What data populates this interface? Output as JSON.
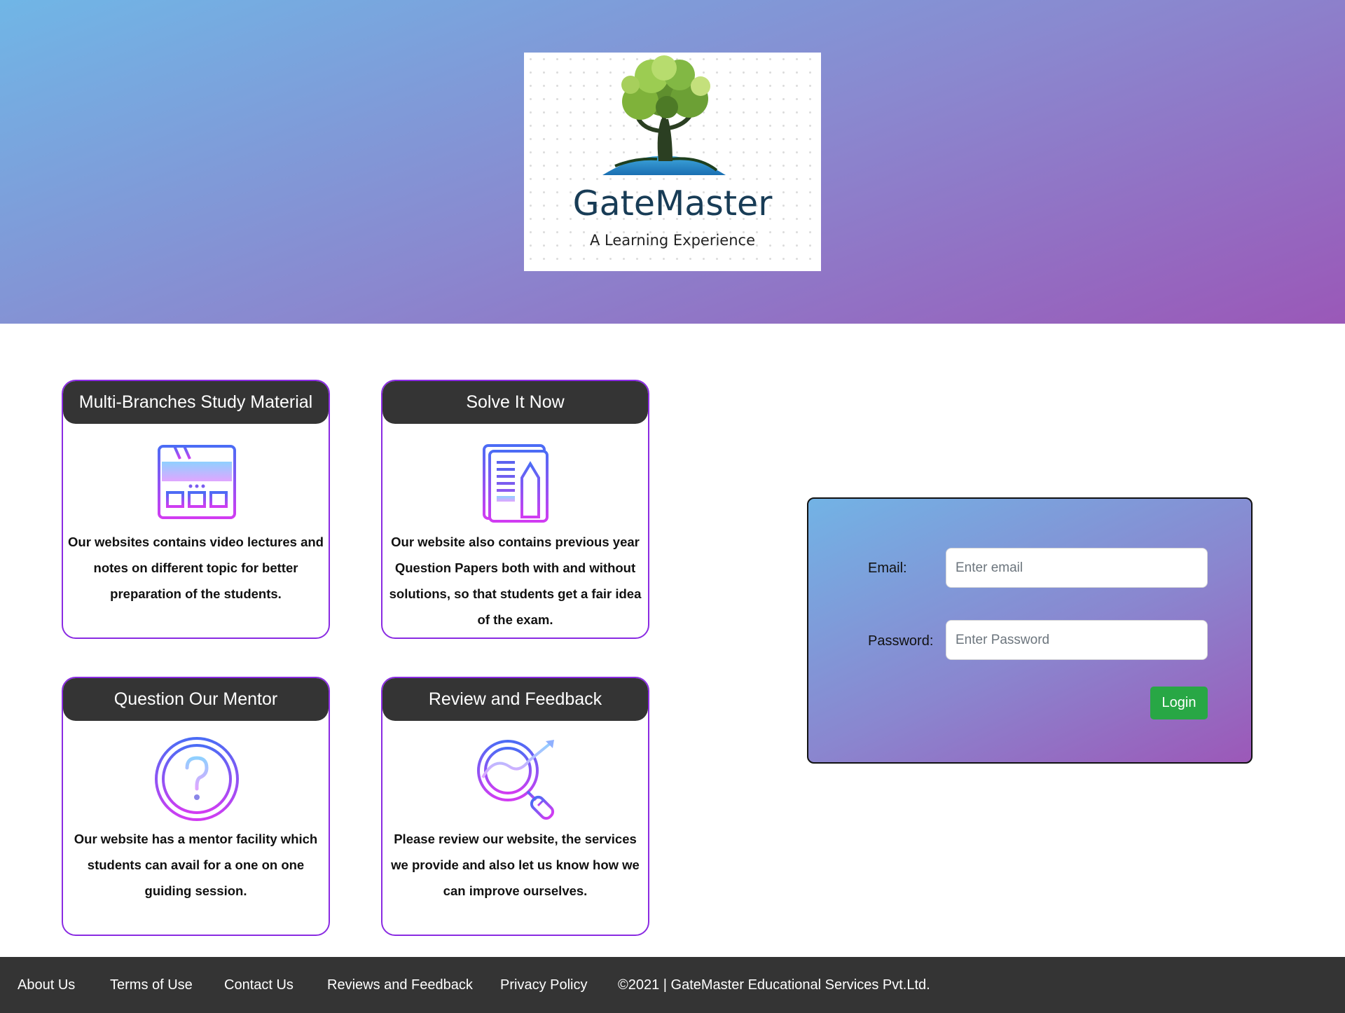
{
  "brand": {
    "name": "GateMaster",
    "tagline": "A Learning Experience"
  },
  "cards": [
    {
      "title": "Multi-Branches Study Material",
      "icon": "video-player-icon",
      "text": "Our websites contains video lectures and notes on different topic for better preparation of the students."
    },
    {
      "title": "Solve It Now",
      "icon": "document-pencil-icon",
      "text": "Our website also contains previous year Question Papers both with and without solutions, so that students get a fair idea of the exam."
    },
    {
      "title": "Question Our Mentor",
      "icon": "question-circle-icon",
      "text": "Our website has a mentor facility which students can avail for a one on one guiding session."
    },
    {
      "title": "Review and Feedback",
      "icon": "magnifier-growth-icon",
      "text": "Please review our website, the services we provide and also let us know how we can improve ourselves."
    }
  ],
  "login": {
    "email_label": "Email:",
    "email_placeholder": "Enter email",
    "password_label": "Password:",
    "password_placeholder": "Enter Password",
    "button_label": "Login"
  },
  "footer": {
    "links": [
      "About Us",
      "Terms of Use",
      "Contact Us",
      "Reviews and Feedback",
      "Privacy Policy"
    ],
    "copyright": "©2021 | GateMaster Educational Services Pvt.Ltd."
  },
  "colors": {
    "hero_start": "#70b6e6",
    "hero_end": "#9a58b8",
    "card_border": "#8a2be2",
    "card_header": "#343434",
    "login_button": "#28a745",
    "footer_bg": "#343434"
  }
}
